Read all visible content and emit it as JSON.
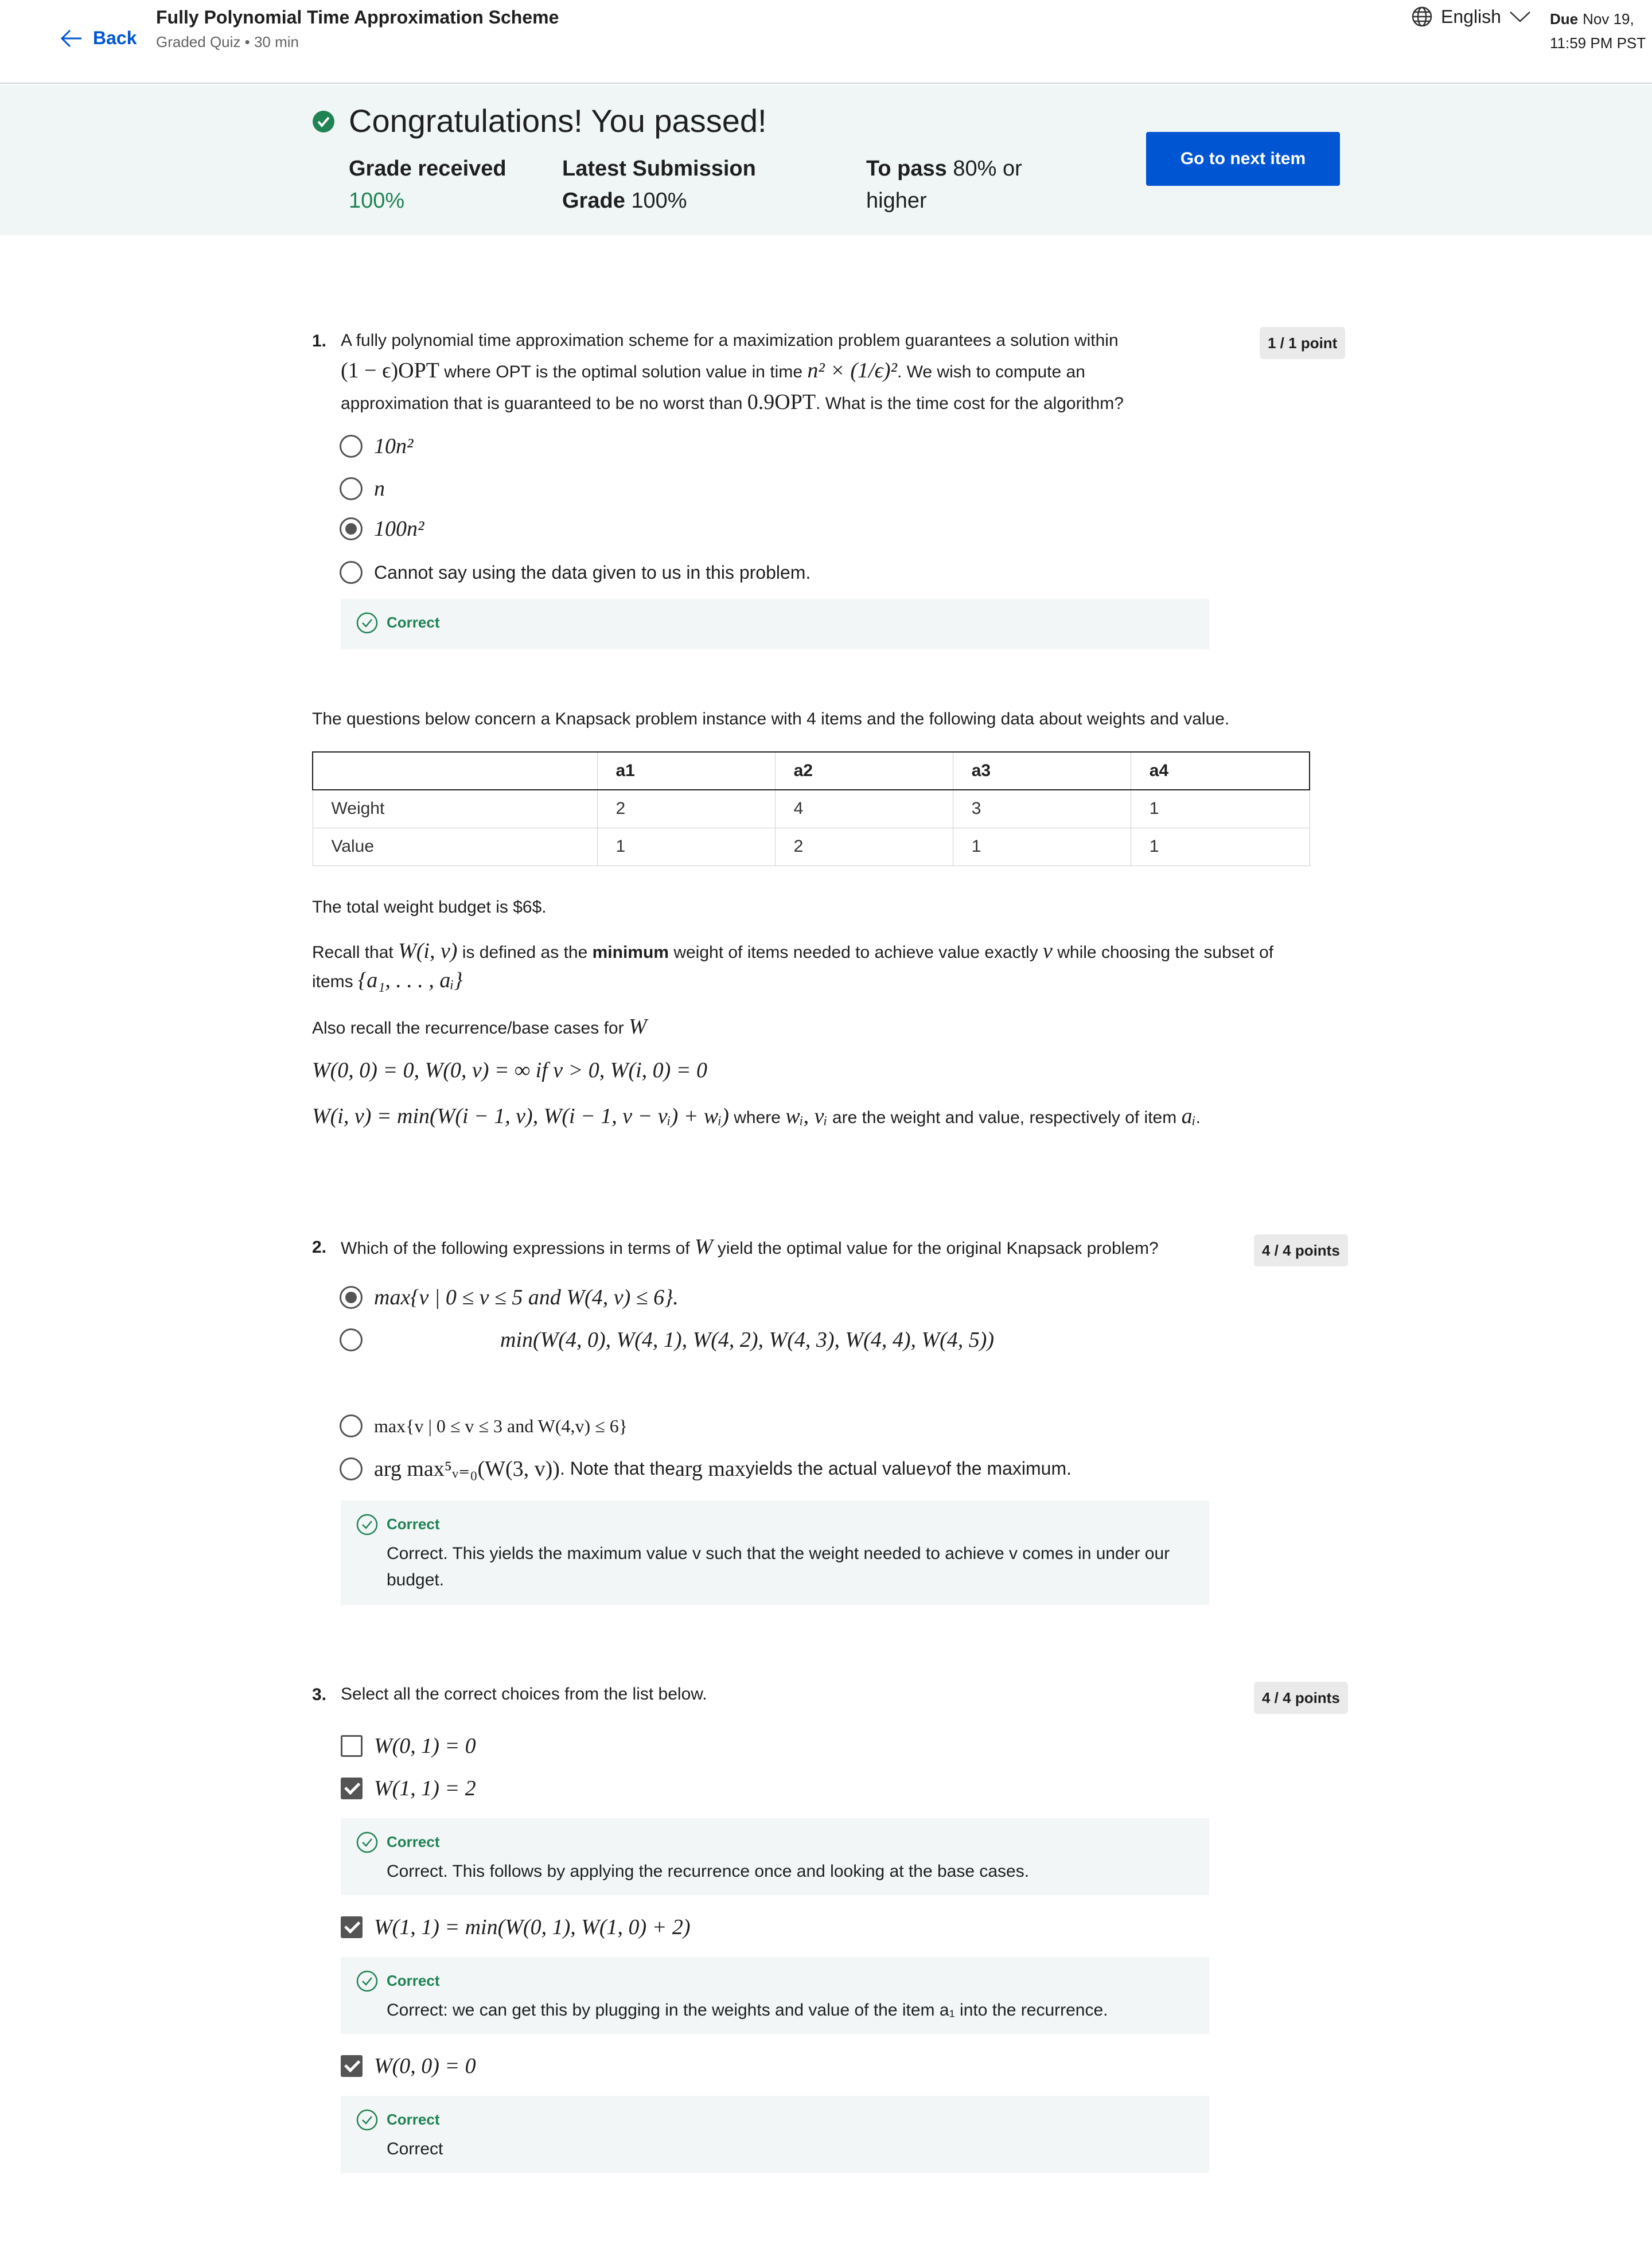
{
  "header": {
    "back_label": "Back",
    "title": "Fully Polynomial Time Approximation Scheme",
    "subtitle": "Graded Quiz • 30 min",
    "language": "English",
    "due_label": "Due",
    "due_date": "Nov 19,",
    "due_time": "11:59 PM PST"
  },
  "banner": {
    "title": "Congratulations! You passed!",
    "grade_received_label": "Grade received",
    "grade_received_value": "100%",
    "latest_label": "Latest Submission Grade",
    "latest_value": "100%",
    "to_pass_label": "To pass",
    "to_pass_value": "80% or higher",
    "next_button": "Go to next item",
    "colors": {
      "accent": "#0056d2",
      "success": "#1f8354",
      "banner_bg": "#f0f6f6"
    }
  },
  "q1": {
    "number": "1.",
    "points": "1 / 1 point",
    "text_a": "A fully polynomial time approximation scheme for a maximization problem guarantees a solution within",
    "text_b1": "(1 − ϵ)OPT",
    "text_b2": " where OPT is the optimal solution value in time ",
    "text_b3": "n² × (1/ϵ)²",
    "text_b4": ". We wish to compute an",
    "text_c1": "approximation that is guaranteed to be no worst than ",
    "text_c2": "0.9OPT",
    "text_c3": ". What is the time cost for the algorithm?",
    "options": [
      "10n²",
      "n",
      "100n²",
      "Cannot say using the data given to us in this problem."
    ],
    "selected": 2,
    "feedback_label": "Correct"
  },
  "knapsack": {
    "intro": "The questions below concern  a Knapsack problem instance with 4 items and the following data about weights and value.",
    "columns": [
      "",
      "a1",
      "a2",
      "a3",
      "a4"
    ],
    "rows": [
      {
        "label": "Weight",
        "values": [
          "2",
          "4",
          "3",
          "1"
        ]
      },
      {
        "label": "Value",
        "values": [
          "1",
          "2",
          "1",
          "1"
        ]
      }
    ],
    "budget": "The total weight budget is $6$.",
    "recall_1a": "Recall that ",
    "recall_1b": "W(i, v)",
    "recall_1c": " is defined as the ",
    "recall_1d": "minimum",
    "recall_1e": " weight of items needed to achieve value exactly ",
    "recall_1f": "v",
    "recall_1g": " while choosing the subset of",
    "recall_2a": "items ",
    "recall_2b": "{a₁, . . . , aᵢ}",
    "recall_3a": "Also recall the recurrence/base cases for ",
    "recall_3b": "W",
    "eq1": "W(0, 0) = 0, W(0, v) = ∞ if v > 0, W(i, 0) = 0",
    "eq2a": "W(i, v) = min(W(i − 1, v), W(i − 1, v − vᵢ) + wᵢ)",
    "eq2b": " where ",
    "eq2c": "wᵢ, vᵢ",
    "eq2d": " are the weight and value, respectively of item ",
    "eq2e": "aᵢ",
    "eq2f": "."
  },
  "q2": {
    "number": "2.",
    "points": "4 / 4 points",
    "text_a": "Which of the following expressions in terms of ",
    "text_b": "W",
    "text_c": " yield the optimal value for the original Knapsack problem?",
    "options": [
      "max{v | 0 ≤ v ≤ 5 and W(4, v) ≤ 6}.",
      "min(W(4, 0), W(4, 1), W(4, 2), W(4, 3), W(4, 4), W(4, 5))",
      "max{v | 0 ≤ v ≤ 3 and W(4,v) ≤ 6}",
      "arg max⁵ᵥ₌₀(W(3, v))"
    ],
    "option4_suffix_a": ". Note that the ",
    "option4_suffix_b": "arg max",
    "option4_suffix_c": " yields the actual value ",
    "option4_suffix_d": "v",
    "option4_suffix_e": " of the maximum.",
    "selected": 0,
    "feedback_label": "Correct",
    "feedback_text": "Correct. This yields the maximum value v such that the weight needed to achieve v comes in under our budget."
  },
  "q3": {
    "number": "3.",
    "points": "4 / 4 points",
    "text": "Select all the correct choices from the list below.",
    "options": [
      {
        "label": "W(0, 1) = 0",
        "checked": false
      },
      {
        "label": "W(1, 1) = 2",
        "checked": true,
        "feedback_label": "Correct",
        "feedback_text": "Correct. This follows by applying the recurrence once and looking at the base cases."
      },
      {
        "label": "W(1, 1) = min(W(0, 1), W(1, 0) + 2)",
        "checked": true,
        "feedback_label": "Correct",
        "feedback_text": "Correct: we can get this by plugging in the weights and value of the item a₁ into the recurrence."
      },
      {
        "label": "W(0, 0) = 0",
        "checked": true,
        "feedback_label": "Correct",
        "feedback_text": "Correct"
      }
    ]
  }
}
